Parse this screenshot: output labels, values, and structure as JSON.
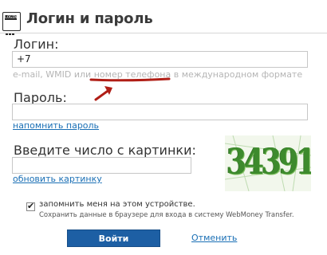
{
  "header": {
    "title": "Логин и пароль",
    "logo_text": "LOGIN"
  },
  "login": {
    "label": "Логин:",
    "value": "+7",
    "hint_before": "e-mail, WMID или",
    "hint_highlight": "номер телефона",
    "hint_after": "в международном формате"
  },
  "password": {
    "label": "Пароль:",
    "value": "",
    "recover_link": "напомнить пароль"
  },
  "captcha": {
    "label": "Введите число с картинки:",
    "value": "",
    "refresh_link": "обновить картинку",
    "image_text": "34391"
  },
  "remember": {
    "checked": true,
    "label": "запомнить меня на этом устройстве.",
    "sub": "Сохранить данные в браузере для входа в систему WebMoney Transfer."
  },
  "actions": {
    "submit": "Войти",
    "cancel": "Отменить"
  },
  "colors": {
    "accent": "#1d5fa4",
    "link": "#1a6fb5",
    "annotation": "#b01e16",
    "captcha_ink": "#3d8a2d"
  }
}
